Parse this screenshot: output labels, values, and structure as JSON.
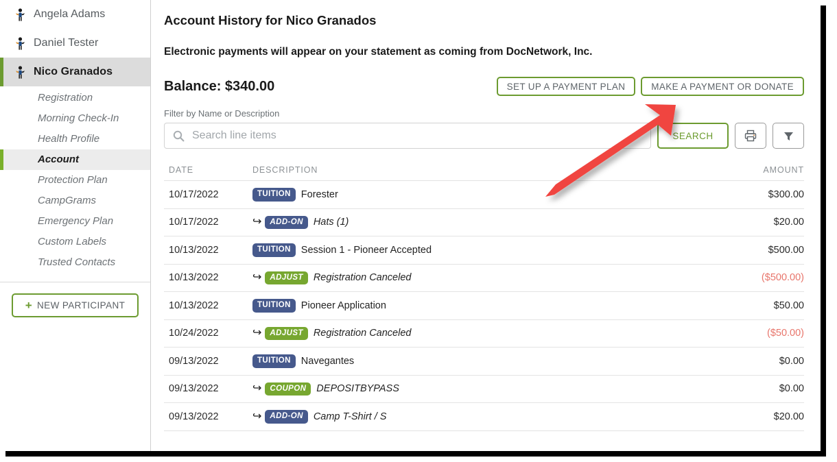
{
  "sidebar": {
    "participants": [
      {
        "name": "Angela Adams",
        "selected": false,
        "icon": "person-icon"
      },
      {
        "name": "Daniel Tester",
        "selected": false,
        "icon": "person-icon"
      },
      {
        "name": "Nico Granados",
        "selected": true,
        "icon": "person-icon"
      }
    ],
    "subnav": [
      {
        "label": "Registration",
        "active": false
      },
      {
        "label": "Morning Check-In",
        "active": false
      },
      {
        "label": "Health Profile",
        "active": false
      },
      {
        "label": "Account",
        "active": true
      },
      {
        "label": "Protection Plan",
        "active": false
      },
      {
        "label": "CampGrams",
        "active": false
      },
      {
        "label": "Emergency Plan",
        "active": false
      },
      {
        "label": "Custom Labels",
        "active": false
      },
      {
        "label": "Trusted Contacts",
        "active": false
      }
    ],
    "new_participant_label": "NEW PARTICIPANT",
    "new_participant_plus": "+"
  },
  "main": {
    "page_title": "Account History for Nico Granados",
    "notice": "Electronic payments will appear on your statement as coming from DocNetwork, Inc.",
    "balance_label": "Balance: $340.00",
    "buttons": {
      "payment_plan": "SET UP A PAYMENT PLAN",
      "make_payment": "MAKE A PAYMENT OR DONATE",
      "search": "SEARCH"
    },
    "filter_label": "Filter by Name or Description",
    "search": {
      "value": "",
      "placeholder": "Search line items",
      "icon": "search-icon"
    },
    "icons": {
      "print": "printer-icon",
      "filter": "funnel-icon"
    },
    "table": {
      "headers": {
        "date": "DATE",
        "description": "DESCRIPTION",
        "amount": "AMOUNT"
      },
      "rows": [
        {
          "date": "10/17/2022",
          "child": false,
          "badge": "TUITION",
          "badge_type": "blue",
          "description": "Forester",
          "desc_italic": false,
          "amount": "$300.00",
          "negative": false
        },
        {
          "date": "10/17/2022",
          "child": true,
          "badge": "ADD-ON",
          "badge_type": "blue",
          "description": "Hats (1)",
          "desc_italic": true,
          "amount": "$20.00",
          "negative": false
        },
        {
          "date": "10/13/2022",
          "child": false,
          "badge": "TUITION",
          "badge_type": "blue",
          "description": "Session 1 - Pioneer Accepted",
          "desc_italic": false,
          "amount": "$500.00",
          "negative": false
        },
        {
          "date": "10/13/2022",
          "child": true,
          "badge": "ADJUST",
          "badge_type": "green",
          "description": "Registration Canceled",
          "desc_italic": true,
          "amount": "($500.00)",
          "negative": true
        },
        {
          "date": "10/13/2022",
          "child": false,
          "badge": "TUITION",
          "badge_type": "blue",
          "description": "Pioneer Application",
          "desc_italic": false,
          "amount": "$50.00",
          "negative": false
        },
        {
          "date": "10/24/2022",
          "child": true,
          "badge": "ADJUST",
          "badge_type": "green",
          "description": "Registration Canceled",
          "desc_italic": true,
          "amount": "($50.00)",
          "negative": true
        },
        {
          "date": "09/13/2022",
          "child": false,
          "badge": "TUITION",
          "badge_type": "blue",
          "description": "Navegantes",
          "desc_italic": false,
          "amount": "$0.00",
          "negative": false
        },
        {
          "date": "09/13/2022",
          "child": true,
          "badge": "COUPON",
          "badge_type": "green",
          "description": "DEPOSITBYPASS",
          "desc_italic": true,
          "amount": "$0.00",
          "negative": false
        },
        {
          "date": "09/13/2022",
          "child": true,
          "badge": "ADD-ON",
          "badge_type": "blue",
          "description": "Camp T-Shirt / S",
          "desc_italic": true,
          "amount": "$20.00",
          "negative": false
        }
      ]
    }
  },
  "annotation": {
    "type": "arrow",
    "color": "#f0453f",
    "points_to": "make-a-payment-or-donate-button"
  },
  "colors": {
    "accent_green": "#6c9b30",
    "badge_blue": "#46598c",
    "badge_green": "#77a730",
    "negative_amount": "#e8756b",
    "annotation_red": "#f0453f"
  }
}
